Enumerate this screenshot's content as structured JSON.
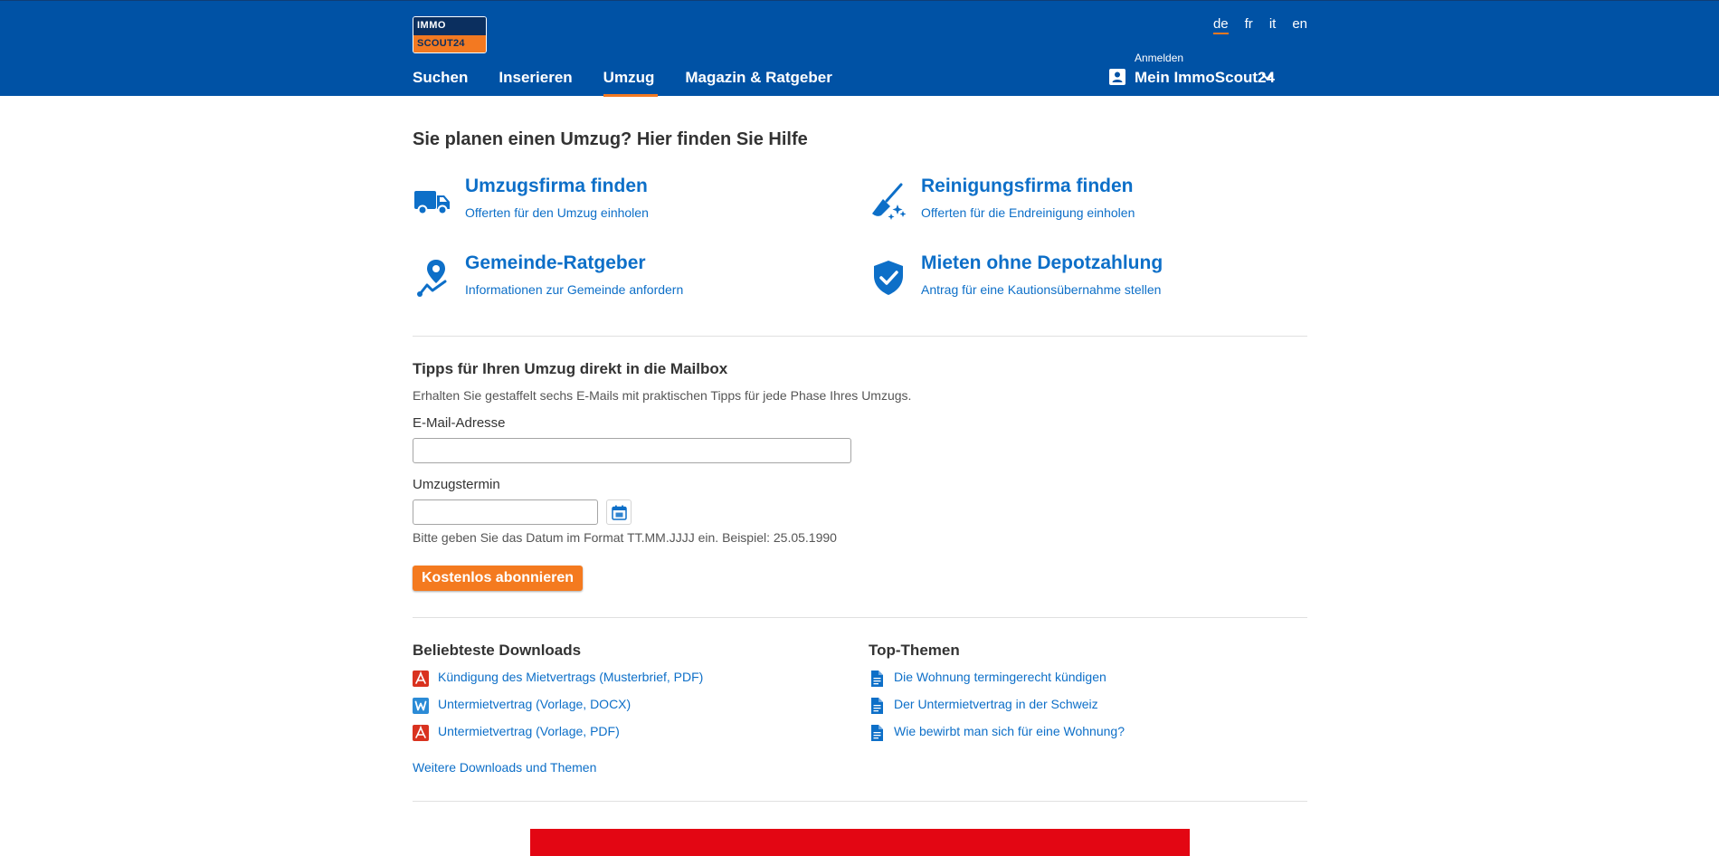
{
  "header": {
    "logo": {
      "top": "IMMO",
      "bottom": "SCOUT24"
    },
    "languages": [
      {
        "code": "de",
        "active": true
      },
      {
        "code": "fr",
        "active": false
      },
      {
        "code": "it",
        "active": false
      },
      {
        "code": "en",
        "active": false
      }
    ],
    "nav": [
      {
        "label": "Suchen",
        "active": false
      },
      {
        "label": "Inserieren",
        "active": false
      },
      {
        "label": "Umzug",
        "active": true
      },
      {
        "label": "Magazin & Ratgeber",
        "active": false
      }
    ],
    "account": {
      "small_label": "Anmelden",
      "label": "Mein ImmoScout24",
      "icon": "account-card-icon"
    }
  },
  "main": {
    "title": "Sie planen einen Umzug? Hier finden Sie Hilfe",
    "services": [
      {
        "icon": "truck-icon",
        "title": "Umzugsfirma finden",
        "subtitle": "Offerten für den Umzug einholen"
      },
      {
        "icon": "broom-sparkle-icon",
        "title": "Reinigungsfirma finden",
        "subtitle": "Offerten für die Endreinigung einholen"
      },
      {
        "icon": "map-pin-route-icon",
        "title": "Gemeinde-Ratgeber",
        "subtitle": "Informationen zur Gemeinde anfordern"
      },
      {
        "icon": "shield-check-icon",
        "title": "Mieten ohne Depotzahlung",
        "subtitle": "Antrag für eine Kautionsübernahme stellen"
      }
    ],
    "newsletter": {
      "title": "Tipps für Ihren Umzug direkt in die Mailbox",
      "description": "Erhalten Sie gestaffelt sechs E-Mails mit praktischen Tipps für jede Phase Ihres Umzugs.",
      "email_label": "E-Mail-Adresse",
      "email_value": "",
      "date_label": "Umzugstermin",
      "date_value": "",
      "calendar_icon": "calendar-icon",
      "date_hint": "Bitte geben Sie das Datum im Format TT.MM.JJJJ ein. Beispiel: 25.05.1990",
      "submit_label": "Kostenlos abonnieren"
    },
    "downloads": {
      "title": "Beliebteste Downloads",
      "items": [
        {
          "label": "Kündigung des Mietvertrags (Musterbrief, PDF)",
          "icon": "pdf-icon"
        },
        {
          "label": "Untermietvertrag (Vorlage, DOCX)",
          "icon": "word-icon"
        },
        {
          "label": "Untermietvertrag (Vorlage, PDF)",
          "icon": "pdf-icon"
        }
      ],
      "more_link": "Weitere Downloads und Themen"
    },
    "topics": {
      "title": "Top-Themen",
      "items": [
        {
          "label": "Die Wohnung termingerecht kündigen",
          "icon": "document-icon"
        },
        {
          "label": "Der Untermietvertrag in der Schweiz",
          "icon": "document-icon"
        },
        {
          "label": "Wie bewirbt man sich für eine Wohnung?",
          "icon": "document-icon"
        }
      ]
    }
  },
  "colors": {
    "header_bg": "#0052a5",
    "accent_orange": "#f47a1f",
    "link_blue": "#0d6fc8",
    "pdf_red": "#d9321f",
    "word_blue": "#2b8bd6",
    "banner_red": "#e30613"
  }
}
